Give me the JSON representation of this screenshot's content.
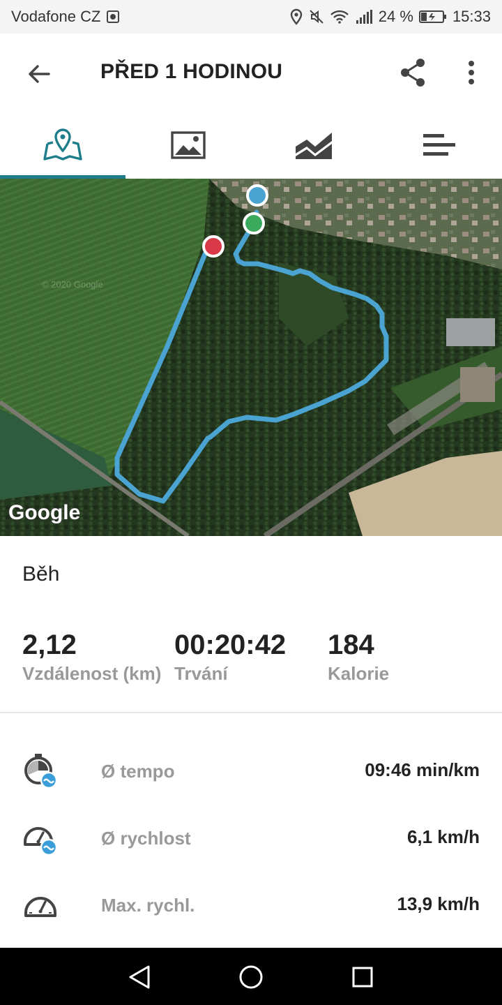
{
  "status_bar": {
    "carrier": "Vodafone CZ",
    "battery": "24 %",
    "time": "15:33",
    "icons": [
      "screenshot-icon",
      "location-icon",
      "mute-icon",
      "wifi-icon",
      "signal-icon",
      "battery-icon"
    ]
  },
  "app_bar": {
    "title": "PŘED 1 HODINOU",
    "icons": [
      "back-arrow-icon",
      "share-icon",
      "more-vert-icon"
    ]
  },
  "tabs": [
    {
      "name": "map-tab",
      "icon": "map-pin-icon",
      "active": true
    },
    {
      "name": "photos-tab",
      "icon": "image-icon",
      "active": false
    },
    {
      "name": "chart-tab",
      "icon": "area-chart-icon",
      "active": false
    },
    {
      "name": "stats-tab",
      "icon": "bars-icon",
      "active": false
    }
  ],
  "map": {
    "logo": "Google",
    "watermark": "© 2020 Google",
    "route_color": "#4aa3d0",
    "marker_colors": {
      "end": "#4aa3d0",
      "start": "#3caa5c",
      "lap": "#d83a4a"
    }
  },
  "activity": {
    "type": "Běh"
  },
  "stats": [
    {
      "value": "2,12",
      "label": "Vzdálenost (km)"
    },
    {
      "value": "00:20:42",
      "label": "Trvání"
    },
    {
      "value": "184",
      "label": "Kalorie"
    }
  ],
  "metrics": [
    {
      "icon": "stopwatch-icon",
      "label": "Ø tempo",
      "value": "09:46 min/km"
    },
    {
      "icon": "speedometer-avg-icon",
      "label": "Ø rychlost",
      "value": "6,1 km/h"
    },
    {
      "icon": "speedometer-icon",
      "label": "Max. rychl.",
      "value": "13,9 km/h"
    }
  ],
  "nav_bar": {
    "icons": [
      "nav-back-icon",
      "nav-home-icon",
      "nav-recents-icon"
    ]
  },
  "colors": {
    "accent": "#1e7d8b",
    "icon_dark": "#444444",
    "badge_blue": "#3a9fd8"
  }
}
